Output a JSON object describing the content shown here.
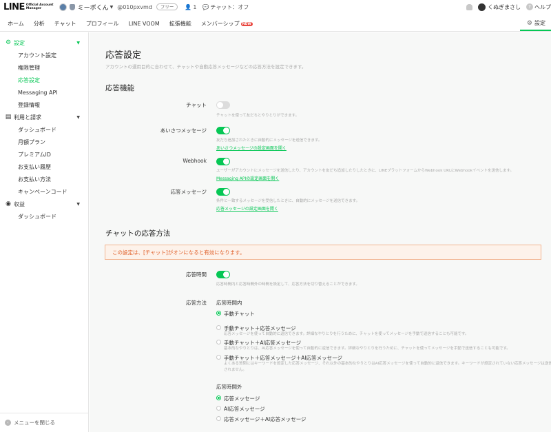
{
  "topbar": {
    "logo_main": "LINE",
    "logo_sub_1": "Official Account",
    "logo_sub_2": "Manager",
    "account_name": "ミーボくん",
    "account_id": "@010pxvmd",
    "plan": "フリー",
    "friends_count": "1",
    "chat_status": "チャット：オフ",
    "user_name": "くぬぎまさし",
    "help": "ヘルプ"
  },
  "nav": {
    "items": [
      "ホーム",
      "分析",
      "チャット",
      "プロフィール",
      "LINE VOOM",
      "拡張機能",
      "メンバーシップ"
    ],
    "new_badge": "NEW",
    "settings": "設定"
  },
  "sidebar": {
    "section_settings": "設定",
    "settings_items": [
      "アカウント設定",
      "権限管理",
      "応答設定",
      "Messaging API",
      "登録情報"
    ],
    "section_billing": "利用と請求",
    "billing_items": [
      "ダッシュボード",
      "月額プラン",
      "プレミアムID",
      "お支払い履歴",
      "お支払い方法",
      "キャンペーンコード"
    ],
    "section_revenue": "収益",
    "revenue_items": [
      "ダッシュボード"
    ],
    "close_menu": "メニューを閉じる"
  },
  "main": {
    "title": "応答設定",
    "description": "アカウントの運用目的に合わせて、チャットや自動応答メッセージなどの応答方法を設定できます。",
    "features_title": "応答機能",
    "features": [
      {
        "label": "チャット",
        "enabled": false,
        "desc": "チャットを使って友だちとやりとりができます。",
        "link": ""
      },
      {
        "label": "あいさつメッセージ",
        "enabled": true,
        "desc": "友だち追加されたときに自動的にメッセージを送信できます。",
        "link": "あいさつメッセージの設定画面を開く"
      },
      {
        "label": "Webhook",
        "enabled": true,
        "desc": "ユーザーがアカウントにメッセージを送信したり、アカウントを友だち追加したりしたときに、LINEプラットフォームからWebhook URLにWebhookイベントを送信します。",
        "link": "Messaging APIの設定画面を開く"
      },
      {
        "label": "応答メッセージ",
        "enabled": true,
        "desc": "条件と一致するメッセージを受信したときに、自動的にメッセージを送信できます。",
        "link": "応答メッセージの設定画面を開く"
      }
    ],
    "chat_method_title": "チャットの応答方法",
    "notice": "この設定は、[チャット]がオンになると有効になります。",
    "hours_label": "応答時間",
    "hours_enabled": true,
    "hours_desc": "応答時間内と応答時間外の時間を設定して、応答方法を切り替えることができます。",
    "method_label": "応答方法",
    "within_hours_label": "応答時間内",
    "within_options": [
      {
        "label": "手動チャット",
        "selected": true,
        "desc": ""
      },
      {
        "label": "手動チャット＋応答メッセージ",
        "selected": false,
        "desc": "応答メッセージを使って自動的に返信できます。詳細なやりとりを行うために、チャットを使ってメッセージを手動で送信することも可能です。"
      },
      {
        "label": "手動チャット＋AI応答メッセージ",
        "selected": false,
        "desc": "基本的なやりとりは、AI応答メッセージを使って自動的に返信できます。詳細なやりとりを行うために、チャットを使ってメッセージを手動で送信することも可能です。"
      },
      {
        "label": "手動チャット＋応答メッセージ＋AI応答メッセージ",
        "selected": false,
        "desc": "よくある質問にはキーワードを設定した応答メッセージ、それ以外の基本的なやりとりはAI応答メッセージを使って自動的に返信できます。キーワードが設定されていない応答メッセージは送信されません。"
      }
    ],
    "outside_hours_label": "応答時間外",
    "outside_options": [
      {
        "label": "応答メッセージ",
        "selected": true
      },
      {
        "label": "AI応答メッセージ",
        "selected": false
      },
      {
        "label": "応答メッセージ＋AI応答メッセージ",
        "selected": false
      }
    ]
  }
}
